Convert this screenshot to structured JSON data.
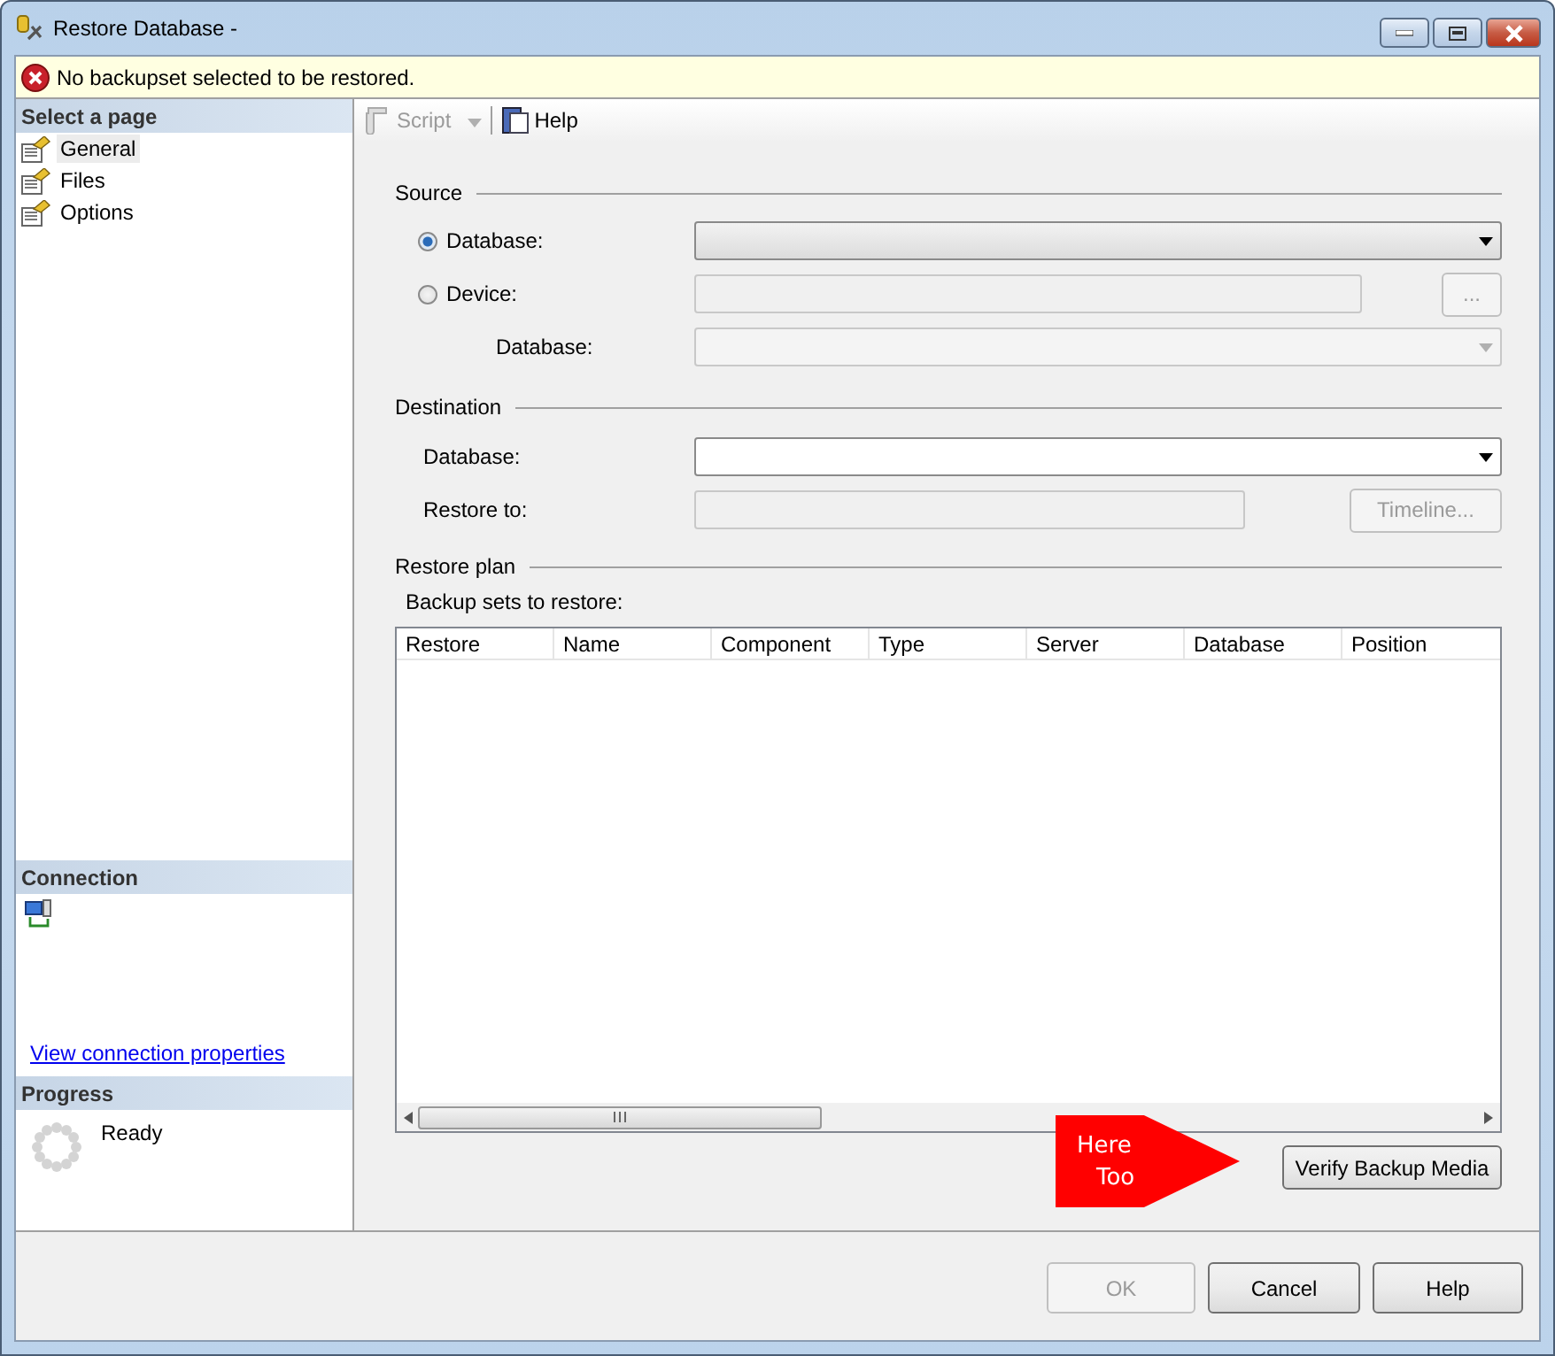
{
  "window": {
    "title": "Restore Database -"
  },
  "message_bar": {
    "kind": "error",
    "text": "No backupset selected to be restored."
  },
  "sidebar": {
    "header": "Select a page",
    "items": [
      {
        "label": "General",
        "selected": true
      },
      {
        "label": "Files",
        "selected": false
      },
      {
        "label": "Options",
        "selected": false
      }
    ],
    "connection": {
      "header": "Connection",
      "link": "View connection properties"
    },
    "progress": {
      "header": "Progress",
      "status": "Ready"
    }
  },
  "toolbar": [
    {
      "label": "Script",
      "disabled": true,
      "has_menu": true
    },
    {
      "label": "Help",
      "disabled": false,
      "has_menu": false
    }
  ],
  "source": {
    "title": "Source",
    "options": [
      {
        "label": "Database:",
        "selected": true
      },
      {
        "label": "Device:",
        "selected": false
      }
    ],
    "browse_button": "...",
    "database_label": "Database:"
  },
  "destination": {
    "title": "Destination",
    "database_label": "Database:",
    "restore_to_label": "Restore to:",
    "timeline_button": {
      "label": "Timeline...",
      "disabled": true
    }
  },
  "restore_plan": {
    "title": "Restore plan",
    "table_label": "Backup sets to restore:",
    "columns": [
      "Restore",
      "Name",
      "Component",
      "Type",
      "Server",
      "Database",
      "Position"
    ],
    "verify_button": "Verify Backup Media"
  },
  "callout": {
    "lines": [
      "Here",
      "Too"
    ]
  },
  "buttons": [
    {
      "label": "OK",
      "disabled": true
    },
    {
      "label": "Cancel",
      "disabled": false
    },
    {
      "label": "Help",
      "disabled": false
    }
  ]
}
